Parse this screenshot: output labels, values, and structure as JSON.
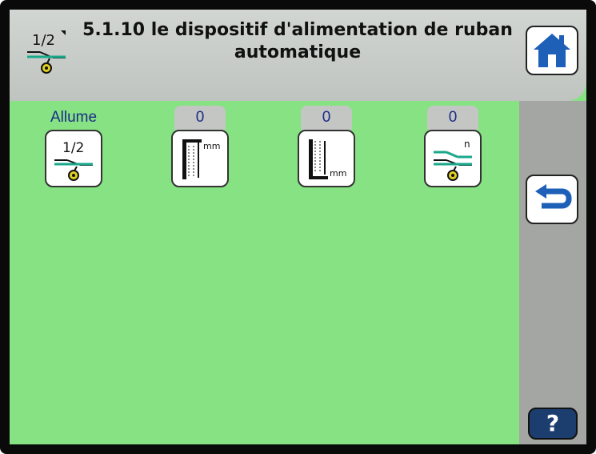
{
  "header": {
    "title": "5.1.10 le dispositif d'alimentation de ruban automatique",
    "icon": "tape-half-feed-icon",
    "icon_text": "1/2"
  },
  "navigation": {
    "home_icon": "home-icon",
    "back_icon": "back-arrow-icon",
    "help_label": "?"
  },
  "settings": [
    {
      "name": "tape-feed-mode",
      "value": "Allume",
      "icon": "tape-half-feed-icon",
      "icon_text": "1/2"
    },
    {
      "name": "upper-length",
      "value": "0",
      "icon": "length-top-mm-icon",
      "unit": "mm"
    },
    {
      "name": "lower-length",
      "value": "0",
      "icon": "length-bottom-mm-icon",
      "unit": "mm"
    },
    {
      "name": "tape-count",
      "value": "0",
      "icon": "tape-count-n-icon",
      "unit": "n"
    }
  ],
  "colors": {
    "screen_bg": "#86e283",
    "header_bg": "#c8ccc8",
    "side_panel": "#a3a6a3",
    "accent_blue": "#1e5fb8",
    "help_bg": "#1c3e6f",
    "label_text": "#1b2a88"
  }
}
